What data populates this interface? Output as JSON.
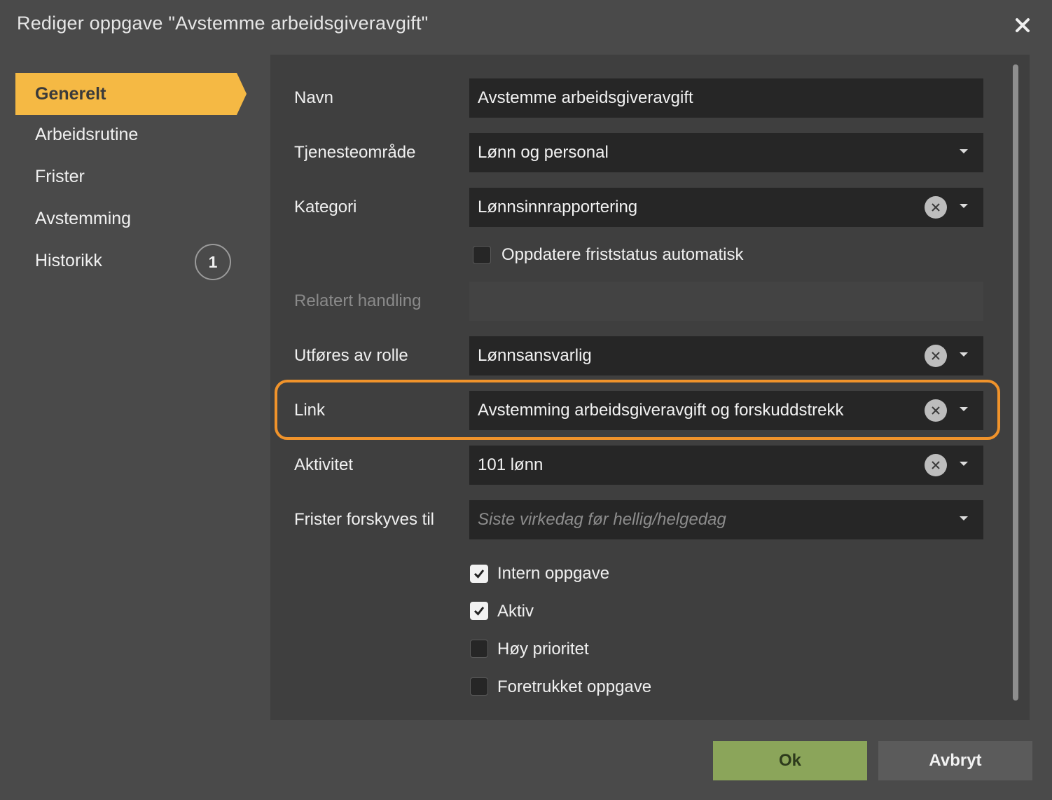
{
  "dialog": {
    "title": "Rediger oppgave \"Avstemme arbeidsgiveravgift\""
  },
  "sidebar": {
    "items": [
      {
        "label": "Generelt",
        "active": true
      },
      {
        "label": "Arbeidsrutine"
      },
      {
        "label": "Frister"
      },
      {
        "label": "Avstemming"
      },
      {
        "label": "Historikk",
        "badge": "1"
      }
    ]
  },
  "form": {
    "navn": {
      "label": "Navn",
      "value": "Avstemme arbeidsgiveravgift"
    },
    "tjenesteomrade": {
      "label": "Tjenesteområde",
      "value": "Lønn og personal"
    },
    "kategori": {
      "label": "Kategori",
      "value": "Lønnsinnrapportering"
    },
    "oppdatere_fristatus": {
      "label": "Oppdatere friststatus automatisk",
      "checked": false
    },
    "relatert_handling": {
      "label": "Relatert handling",
      "value": ""
    },
    "utfores_av_rolle": {
      "label": "Utføres av rolle",
      "value": "Lønnsansvarlig"
    },
    "link": {
      "label": "Link",
      "value": "Avstemming arbeidsgiveravgift og forskuddstrekk"
    },
    "aktivitet": {
      "label": "Aktivitet",
      "value": "101 lønn"
    },
    "frister_forskyves": {
      "label": "Frister forskyves til",
      "placeholder": "Siste virkedag før hellig/helgedag"
    },
    "checkboxes": [
      {
        "label": "Intern oppgave",
        "checked": true
      },
      {
        "label": "Aktiv",
        "checked": true
      },
      {
        "label": "Høy prioritet",
        "checked": false
      },
      {
        "label": "Foretrukket oppgave",
        "checked": false
      }
    ]
  },
  "buttons": {
    "ok": "Ok",
    "cancel": "Avbryt"
  },
  "colors": {
    "accent": "#f5b944",
    "highlight": "#f0932b",
    "ok_button": "#8ba55a"
  }
}
